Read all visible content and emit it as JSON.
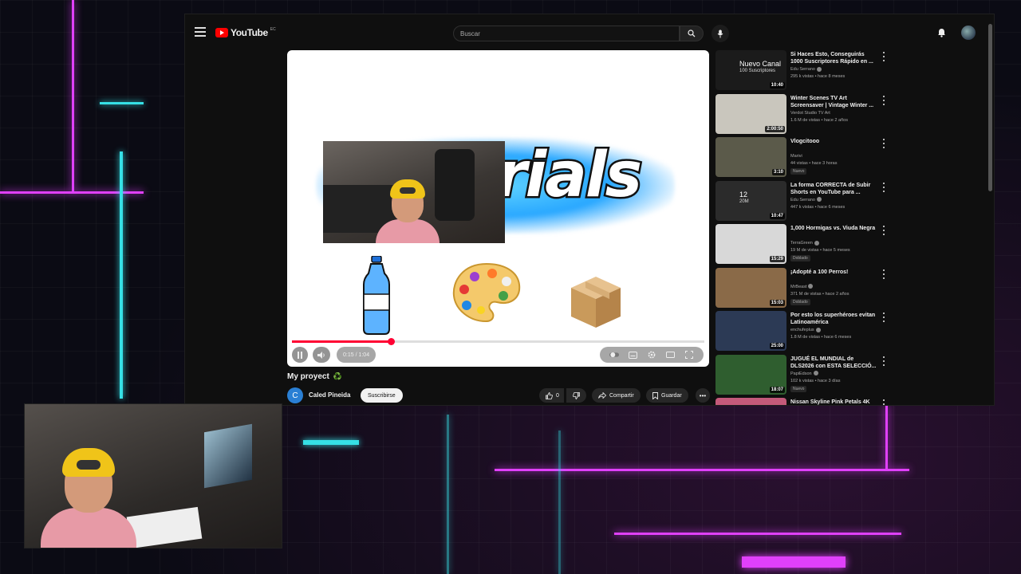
{
  "app": {
    "brand": "YouTube",
    "country_code": "EC"
  },
  "search": {
    "placeholder": "Buscar"
  },
  "player": {
    "overlay_word": "rials",
    "time_display": "0:15 / 1:04",
    "progress_fraction": 0.24
  },
  "video": {
    "title": "My proyect",
    "title_emoji": "♻️",
    "channel_initial": "C",
    "channel_name": "Caled Pineida",
    "subscribe_label": "Suscribirse",
    "like_count": "0",
    "share_label": "Compartir",
    "save_label": "Guardar"
  },
  "recommendations": [
    {
      "title": "Si Haces Esto, Conseguirás 1000 Suscriptores Rápido en ...",
      "channel": "Edu Serrano",
      "verified": true,
      "meta": "295 k vistas • hace 8 meses",
      "duration": "10:40",
      "badge": "",
      "thumb_text": "Nuevo Canal",
      "thumb_sub": "100 Suscriptores",
      "thumb_color": "#1b1b1b"
    },
    {
      "title": "Winter Scenes TV Art Screensaver | Vintage Winter ...",
      "channel": "Verdot Studio TV Art",
      "verified": false,
      "meta": "1.6 M de vistas • hace 2 años",
      "duration": "2:00:50",
      "badge": "",
      "thumb_text": "",
      "thumb_sub": "",
      "thumb_color": "#c9c6bd"
    },
    {
      "title": "Vlogcitooo",
      "channel": "Marivi",
      "verified": false,
      "meta": "44 vistas • hace 3 horas",
      "duration": "3:10",
      "badge": "Nuevo",
      "thumb_text": "",
      "thumb_sub": "",
      "thumb_color": "#5b5a4a"
    },
    {
      "title": "La forma CORRECTA de Subir Shorts en YouTube para ...",
      "channel": "Edu Serrano",
      "verified": true,
      "meta": "447 k vistas • hace 6 meses",
      "duration": "10:47",
      "badge": "",
      "thumb_text": "12",
      "thumb_sub": "20M",
      "thumb_color": "#2b2b2b"
    },
    {
      "title": "1,000 Hormigas vs. Viuda Negra",
      "channel": "TerraGreen",
      "verified": true,
      "meta": "19 M de vistas • hace 5 meses",
      "duration": "15:29",
      "badge": "Doblado",
      "thumb_text": "",
      "thumb_sub": "",
      "thumb_color": "#d8d8d8"
    },
    {
      "title": "¡Adopté a 100 Perros!",
      "channel": "MrBeast",
      "verified": true,
      "meta": "371 M de vistas • hace 2 años",
      "duration": "15:03",
      "badge": "Doblado",
      "thumb_text": "",
      "thumb_sub": "",
      "thumb_color": "#8a6a48"
    },
    {
      "title": "Por esto los superhéroes evitan Latinoamérica",
      "channel": "enchufeplus",
      "verified": true,
      "meta": "1.8 M de vistas • hace 6 meses",
      "duration": "25:00",
      "badge": "",
      "thumb_text": "",
      "thumb_sub": "",
      "thumb_color": "#2c3a55"
    },
    {
      "title": "JUGUÉ EL MUNDIAL de DLS2026 con ESTA SELECCIÓ...",
      "channel": "PapiEdson",
      "verified": true,
      "meta": "102 k vistas • hace 3 días",
      "duration": "18:07",
      "badge": "Nuevo",
      "thumb_text": "",
      "thumb_sub": "",
      "thumb_color": "#2f5e2f"
    },
    {
      "title": "Nissan Skyline Pink Petals 4K",
      "channel": "",
      "verified": false,
      "meta": "",
      "duration": "",
      "badge": "",
      "thumb_text": "",
      "thumb_sub": "",
      "thumb_color": "#c45a7a"
    }
  ],
  "colors": {
    "accent": "#ff0033",
    "neon_pink": "#e040fb",
    "neon_cyan": "#36e0e6"
  }
}
